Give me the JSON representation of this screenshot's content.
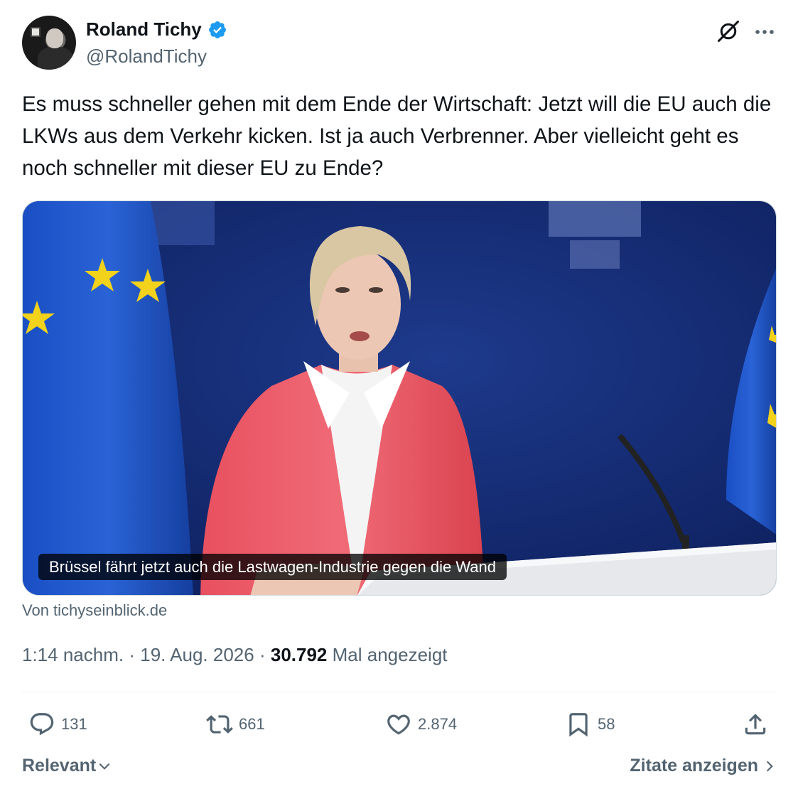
{
  "author": {
    "name": "Roland Tichy",
    "handle": "@RolandTichy",
    "verified": true
  },
  "tweet": {
    "text": "Es muss schneller gehen mit dem Ende der Wirtschaft: Jetzt will die EU auch die LKWs aus dem Verkehr kicken. Ist ja auch Verbrenner. Aber vielleicht geht es noch schneller mit dieser EU zu Ende?"
  },
  "card": {
    "title": "Brüssel fährt jetzt auch die Lastwagen-Industrie gegen die Wand",
    "source": "Von tichyseinblick.de"
  },
  "meta": {
    "time": "1:14 nachm.",
    "separator": "·",
    "date": "19. Aug. 2026",
    "views_count": "30.792",
    "views_label": "Mal angezeigt"
  },
  "actions": {
    "replies": "131",
    "retweets": "661",
    "likes": "2.874",
    "bookmarks": "58"
  },
  "footer": {
    "sort_label": "Relevant",
    "quotes_label": "Zitate anzeigen"
  },
  "colors": {
    "text": "#0f1419",
    "secondary": "#536471",
    "verified": "#1d9bf0",
    "border": "#eff3f4"
  },
  "icons": [
    "verified-badge-icon",
    "grok-icon",
    "more-icon",
    "reply-icon",
    "retweet-icon",
    "like-icon",
    "bookmark-icon",
    "share-icon",
    "chevron-down-icon",
    "chevron-right-icon"
  ]
}
